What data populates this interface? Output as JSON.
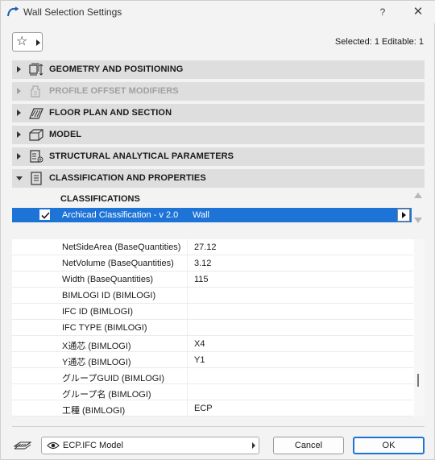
{
  "window": {
    "title": "Wall Selection Settings",
    "help_label": "?",
    "close_label": "✕"
  },
  "toolbar": {
    "favorites_icon": "star-icon",
    "favorites_glyph": "☆",
    "selection_info": "Selected: 1 Editable: 1"
  },
  "panels": [
    {
      "label": "GEOMETRY AND POSITIONING",
      "icon": "geometry-icon",
      "expanded": false,
      "enabled": true
    },
    {
      "label": "PROFILE OFFSET MODIFIERS",
      "icon": "profile-offset-icon",
      "expanded": false,
      "enabled": false
    },
    {
      "label": "FLOOR PLAN AND SECTION",
      "icon": "floor-plan-icon",
      "expanded": false,
      "enabled": true
    },
    {
      "label": "MODEL",
      "icon": "model-icon",
      "expanded": false,
      "enabled": true
    },
    {
      "label": "STRUCTURAL ANALYTICAL PARAMETERS",
      "icon": "structural-icon",
      "expanded": false,
      "enabled": true
    },
    {
      "label": "CLASSIFICATION AND PROPERTIES",
      "icon": "classification-icon",
      "expanded": true,
      "enabled": true
    }
  ],
  "classification": {
    "heading": "CLASSIFICATIONS",
    "rows": [
      {
        "checked": true,
        "name": "Archicad Classification - v 2.0",
        "value": "Wall"
      }
    ]
  },
  "properties": [
    {
      "name": "NetSideArea (BaseQuantities)",
      "value": "27.12"
    },
    {
      "name": "NetVolume (BaseQuantities)",
      "value": "3.12"
    },
    {
      "name": "Width (BaseQuantities)",
      "value": "115"
    },
    {
      "name": "BIMLOGI ID (BIMLOGI)",
      "value": ""
    },
    {
      "name": "IFC ID (BIMLOGI)",
      "value": ""
    },
    {
      "name": "IFC TYPE (BIMLOGI)",
      "value": ""
    },
    {
      "name": "X通芯 (BIMLOGI)",
      "value": "X4"
    },
    {
      "name": "Y通芯 (BIMLOGI)",
      "value": "Y1"
    },
    {
      "name": "グループGUID (BIMLOGI)",
      "value": ""
    },
    {
      "name": "グループ名 (BIMLOGI)",
      "value": ""
    },
    {
      "name": "工種 (BIMLOGI)",
      "value": "ECP"
    }
  ],
  "footer": {
    "layer_icon": "layer-icon",
    "layer_value": "ECP.IFC Model",
    "cancel_label": "Cancel",
    "ok_label": "OK"
  },
  "colors": {
    "selection": "#1d73d6",
    "panel_header": "#dedede",
    "dialog_bg": "#f3f3f3"
  }
}
